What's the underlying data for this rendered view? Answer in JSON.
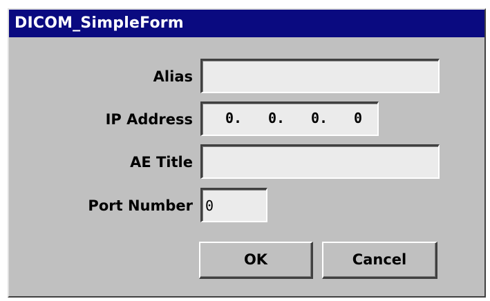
{
  "window": {
    "title": "DICOM_SimpleForm"
  },
  "form": {
    "alias_label": "Alias",
    "alias_value": "",
    "ip_label": "IP Address",
    "ip_octets": [
      "0.",
      "0.",
      "0.",
      "0"
    ],
    "ae_title_label": "AE Title",
    "ae_title_value": "",
    "port_label": "Port Number",
    "port_value": "0"
  },
  "buttons": {
    "ok": "OK",
    "cancel": "Cancel"
  },
  "colors": {
    "titlebar": "#0a0a80",
    "dialog_bg": "#c0c0c0",
    "field_bg": "#ebebeb"
  }
}
